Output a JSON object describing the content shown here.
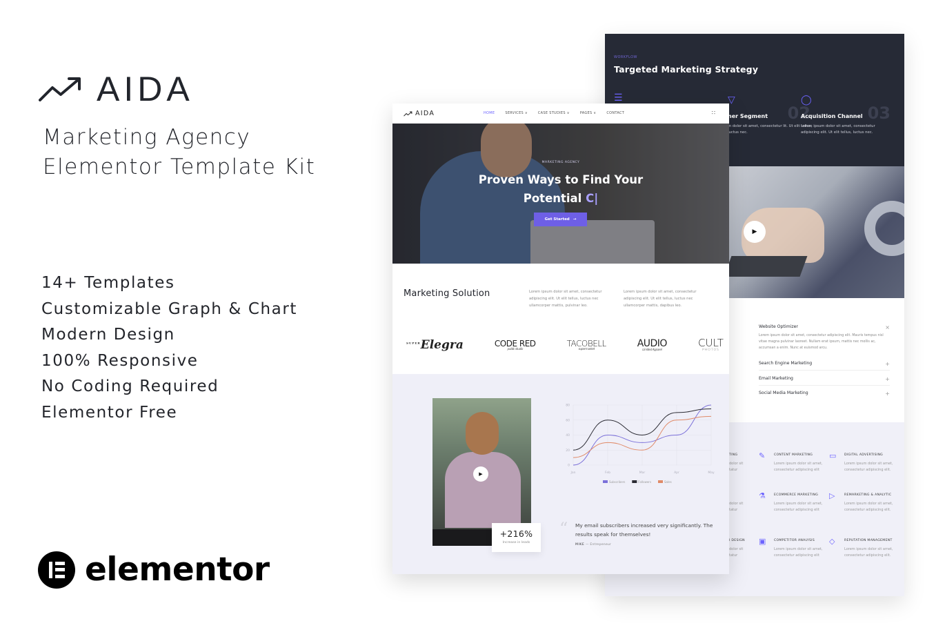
{
  "promo": {
    "brand_name": "AIDA",
    "subtitle_line1": "Marketing Agency",
    "subtitle_line2": "Elementor Template Kit",
    "features": [
      "14+ Templates",
      "Customizable Graph & Chart",
      "Modern Design",
      "100% Responsive",
      "No Coding Required",
      "Elementor Free"
    ],
    "elementor_word": "elementor"
  },
  "front": {
    "nav": {
      "logo": "AIDA",
      "links": [
        {
          "label": "HOME",
          "active": true
        },
        {
          "label": "SERVICES ∨",
          "active": false
        },
        {
          "label": "CASE STUDIES ∨",
          "active": false
        },
        {
          "label": "PAGES ∨",
          "active": false
        },
        {
          "label": "CONTACT",
          "active": false
        }
      ],
      "grid_icon": "∷"
    },
    "hero": {
      "kicker": "MARKETING AGENCY",
      "title_line1": "Proven Ways to Find Your",
      "title_line2": "Potential ",
      "typed": "C|",
      "button": "Get Started",
      "button_arrow": "→"
    },
    "solution": {
      "title": "Marketing Solution",
      "text1": "Lorem ipsum dolor sit amet, consectetur adipiscing elit. Ut elit tellus, luctus nec ullamcorper mattis, pulvinar leo.",
      "text2": "Lorem ipsum dolor sit amet, consectetur adipiscing elit. Ut elit tellus, luctus nec ullamcorper mattis, dapibus leo."
    },
    "logos": [
      {
        "name": "Elegra",
        "tag": "SUPER"
      },
      {
        "name": "CODE RED",
        "tag": "public studio"
      },
      {
        "name": "TACOBELL",
        "tag": "supermarket"
      },
      {
        "name": "AUDIO",
        "tag": "Limited Apparel"
      },
      {
        "name": "CULT",
        "tag": "PHOTOS"
      }
    ],
    "stat": {
      "value": "+216%",
      "label": "Increase in leads"
    },
    "quote": {
      "mark": "“",
      "text": "My email subscribers increased very significantly. The results speak for themselves!",
      "author": "MIKE",
      "role": "Entrepeneur"
    }
  },
  "chart_data": {
    "type": "line",
    "categories": [
      "Jan",
      "Feb",
      "Mar",
      "Apr",
      "May"
    ],
    "series": [
      {
        "name": "Subscribers",
        "color": "#7b70d9",
        "values": [
          0,
          40,
          30,
          40,
          80
        ]
      },
      {
        "name": "Followers",
        "color": "#2b2b33",
        "values": [
          20,
          60,
          40,
          70,
          75
        ]
      },
      {
        "name": "Sales",
        "color": "#e08a68",
        "values": [
          10,
          30,
          20,
          60,
          65
        ]
      }
    ],
    "title": "",
    "xlabel": "",
    "ylabel": "",
    "ylim": [
      0,
      80
    ],
    "yticks": [
      0,
      20,
      40,
      60,
      80
    ],
    "grid": true,
    "legend": "bottom"
  },
  "back": {
    "kicker": "WORKFLOW",
    "title": "Targeted Marketing Strategy",
    "steps": [
      {
        "title": "ner Segment",
        "num": "02",
        "text": "m dolor sit amet, consectetur lit. Ut elit tellus, luctus nec."
      },
      {
        "title": "Acquisition Channel",
        "num": "03",
        "text": "Lorem ipsum dolor sit amet, consectetur adipiscing elit. Ut elit tellus, luctus nec."
      }
    ],
    "accordion": [
      {
        "title": "Website Optimizer",
        "sign": "×",
        "text": "Lorem ipsum dolor sit amet, consectetur adipiscing elit. Mauris tempus nisl vitae magna pulvinar laoreet. Nullam erat ipsum, mattis nec mollis ac, accumsan a enim. Nunc at euismod arcu."
      },
      {
        "title": "Search Engine Marketing",
        "sign": "+"
      },
      {
        "title": "Email Marketing",
        "sign": "+"
      },
      {
        "title": "Social Media Marketing",
        "sign": "+"
      }
    ],
    "services": [
      {
        "name": "CONTENT MARKETING",
        "icon": "✎",
        "text": "Lorem ipsum dolor sit amet, consectetur adipiscing elit"
      },
      {
        "name": "DIGITAL ADVERTISING",
        "icon": "▭",
        "text": "Lorem ipsum dolor sit amet, consectetur adipiscing elit."
      },
      {
        "name": "ECOMMERCE MARKETING",
        "icon": "⚗",
        "text": "Lorem ipsum dolor sit amet, consectetur adipiscing elit"
      },
      {
        "name": "REMARKETING & ANALYTIC",
        "icon": "▷",
        "text": "Lorem ipsum dolor sit amet, consectetur adipiscing elit."
      },
      {
        "name": "COMPETITOR ANALYSIS",
        "icon": "▣",
        "text": "Lorem ipsum dolor sit amet, consectetur adipiscing elit"
      },
      {
        "name": "REPUTATION MANAGEMENT",
        "icon": "◇",
        "text": "Lorem ipsum dolor sit amet, consectetur adipiscing elit."
      }
    ],
    "partial_services": [
      {
        "name": "TING",
        "text": "dolor sit tatur"
      },
      {
        "name": "",
        "text": "dolor sit tatur"
      },
      {
        "name": "I DESIGN",
        "text": "dolor sit tatur"
      }
    ]
  }
}
